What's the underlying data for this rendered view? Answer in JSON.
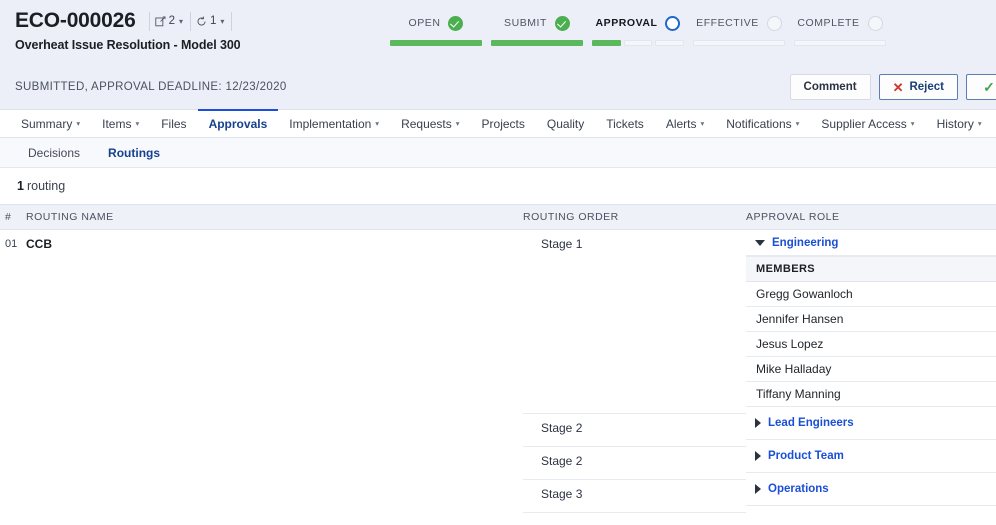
{
  "header": {
    "doc_id": "ECO-000026",
    "doc_subtitle": "Overheat Issue Resolution - Model 300",
    "chips": [
      {
        "icon": "note-edit-icon",
        "value": "2"
      },
      {
        "icon": "revision-cycle-icon",
        "value": "1"
      }
    ],
    "status_text": "SUBMITTED, APPROVAL DEADLINE: 12/23/2020",
    "buttons": {
      "comment": "Comment",
      "reject": "Reject",
      "approve": ""
    }
  },
  "workflow": {
    "steps": [
      {
        "label": "OPEN",
        "state": "done",
        "segments": [
          1
        ]
      },
      {
        "label": "SUBMIT",
        "state": "done",
        "segments": [
          1
        ]
      },
      {
        "label": "APPROVAL",
        "state": "current",
        "segments": [
          1,
          0,
          0
        ]
      },
      {
        "label": "EFFECTIVE",
        "state": "todo",
        "segments": [
          0
        ]
      },
      {
        "label": "COMPLETE",
        "state": "todo",
        "segments": [
          0
        ]
      }
    ]
  },
  "tabs": [
    {
      "label": "Summary",
      "caret": true,
      "active": false
    },
    {
      "label": "Items",
      "caret": true,
      "active": false
    },
    {
      "label": "Files",
      "caret": false,
      "active": false
    },
    {
      "label": "Approvals",
      "caret": false,
      "active": true
    },
    {
      "label": "Implementation",
      "caret": true,
      "active": false
    },
    {
      "label": "Requests",
      "caret": true,
      "active": false
    },
    {
      "label": "Projects",
      "caret": false,
      "active": false
    },
    {
      "label": "Quality",
      "caret": false,
      "active": false
    },
    {
      "label": "Tickets",
      "caret": false,
      "active": false
    },
    {
      "label": "Alerts",
      "caret": true,
      "active": false
    },
    {
      "label": "Notifications",
      "caret": true,
      "active": false
    },
    {
      "label": "Supplier Access",
      "caret": true,
      "active": false
    },
    {
      "label": "History",
      "caret": true,
      "active": false
    }
  ],
  "subtabs": [
    {
      "label": "Decisions",
      "active": false
    },
    {
      "label": "Routings",
      "active": true
    }
  ],
  "list": {
    "count_number": "1",
    "count_label": "routing"
  },
  "table": {
    "columns": {
      "num": "#",
      "name": "ROUTING NAME",
      "order": "ROUTING ORDER",
      "role": "APPROVAL ROLE"
    },
    "row": {
      "num": "01",
      "name": "CCB"
    },
    "stages": [
      {
        "order": "Stage 1",
        "role": "Engineering",
        "expanded": true
      },
      {
        "order": "Stage 2",
        "role": "Lead Engineers",
        "expanded": false
      },
      {
        "order": "Stage 2",
        "role": "Product Team",
        "expanded": false
      },
      {
        "order": "Stage 3",
        "role": "Operations",
        "expanded": false
      }
    ],
    "members_header": "MEMBERS",
    "members": [
      "Gregg Gowanloch",
      "Jennifer Hansen",
      "Jesus Lopez",
      "Mike Halladay",
      "Tiffany Manning"
    ]
  },
  "colors": {
    "accent_blue": "#1a4fd6",
    "done_green": "#4caf4f",
    "reject_red": "#d0342c",
    "header_bg": "#eceff7"
  }
}
